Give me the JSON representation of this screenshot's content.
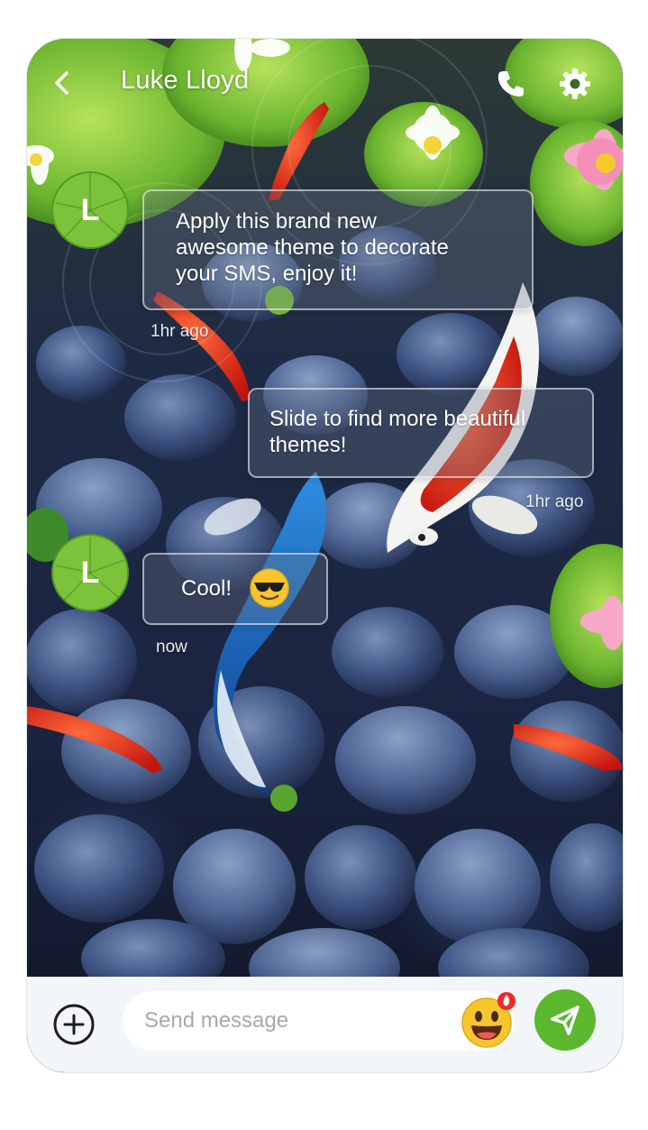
{
  "header": {
    "contact_name": "Luke Lloyd",
    "back_icon": "chevron-left-icon",
    "call_icon": "phone-icon",
    "settings_icon": "gear-icon"
  },
  "messages": [
    {
      "direction": "incoming",
      "avatar_letter": "L",
      "text": "Apply this brand new\nawesome theme to decorate\nyour SMS, enjoy it!",
      "time": "1hr ago"
    },
    {
      "direction": "outgoing",
      "text": "Slide to find more beautiful\nthemes!",
      "time": "1hr ago"
    },
    {
      "direction": "incoming",
      "avatar_letter": "L",
      "text": "Cool!",
      "emoji": "sunglasses-emoji",
      "time": "now"
    }
  ],
  "composer": {
    "placeholder": "Send message",
    "add_icon": "plus-circle-icon",
    "emoji_icon": "smiley-emoji-icon",
    "send_icon": "paper-plane-icon"
  },
  "colors": {
    "accent": "#5cb82f",
    "avatar_green": "#7cc23a",
    "bubble_border": "#ffffff",
    "composer_bg": "#f3f6f9"
  }
}
